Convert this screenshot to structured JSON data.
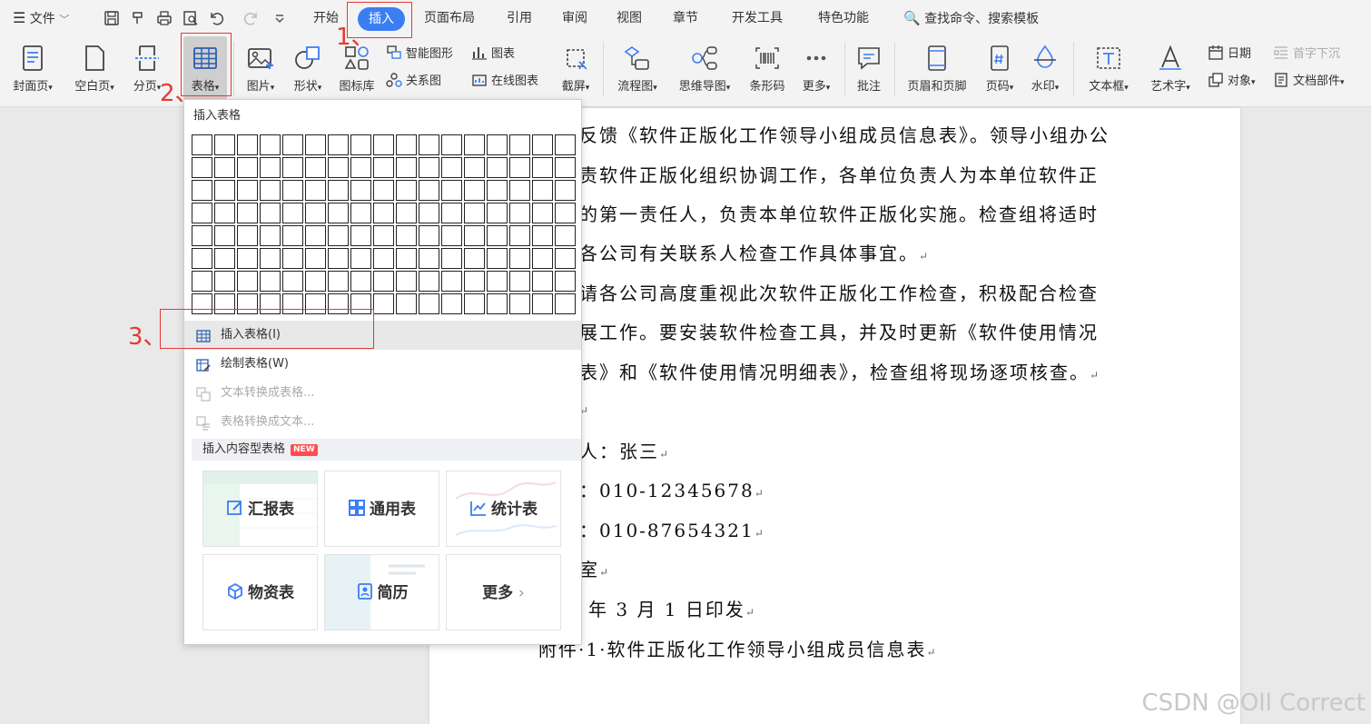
{
  "menubar": {
    "file": "文件",
    "tabs": [
      "开始",
      "插入",
      "页面布局",
      "引用",
      "审阅",
      "视图",
      "章节",
      "开发工具",
      "特色功能"
    ],
    "search": "查找命令、搜索模板"
  },
  "ribbon": {
    "cover": "封面页",
    "blank": "空白页",
    "break": "分页",
    "table": "表格",
    "picture": "图片",
    "shape": "形状",
    "iconlib": "图标库",
    "smartart": "智能图形",
    "relation": "关系图",
    "chart": "图表",
    "online_chart": "在线图表",
    "screenshot": "截屏",
    "flowchart": "流程图",
    "mindmap": "思维导图",
    "barcode": "条形码",
    "more": "更多",
    "comment": "批注",
    "header_footer": "页眉和页脚",
    "page_num": "页码",
    "watermark": "水印",
    "textbox": "文本框",
    "wordart": "艺术字",
    "date": "日期",
    "dropcap": "首字下沉",
    "object": "对象",
    "docpart": "文档部件"
  },
  "dropdown": {
    "title": "插入表格",
    "insert_table": "插入表格(I)",
    "draw_table": "绘制表格(W)",
    "text_to_table": "文本转换成表格...",
    "table_to_text": "表格转换成文本...",
    "content_section": "插入内容型表格",
    "new_badge": "NEW",
    "cards": [
      "汇报表",
      "通用表",
      "统计表",
      "物资表",
      "简历",
      "更多"
    ]
  },
  "document": {
    "lines": [
      "反馈《软件正版化工作领导小组成员信息表》。领导小组办公",
      "责软件正版化组织协调工作，各单位负责人为本单位软件正",
      "的第一责任人，负责本单位软件正版化实施。检查组将适时",
      "各公司有关联系人检查工作具体事宜。",
      "请各公司高度重视此次软件正版化工作检查，积极配合检查",
      "展工作。要安装软件检查工具，并及时更新《软件使用情况",
      "表》和《软件使用情况明细表》，检查组将现场逐项核查。",
      "",
      "人：张三",
      "：010-12345678",
      "：010-87654321",
      "室",
      "年 3 月 1 日印发",
      "附件·1·软件正版化工作领导小组成员信息表"
    ]
  },
  "annotations": {
    "step1": "1、",
    "step2": "2、",
    "step3": "3、"
  },
  "watermark": "CSDN @Oll Correct",
  "colors": {
    "accent": "#3b7ef4",
    "annotation": "#e53935",
    "badge": "#ff4d4f"
  }
}
